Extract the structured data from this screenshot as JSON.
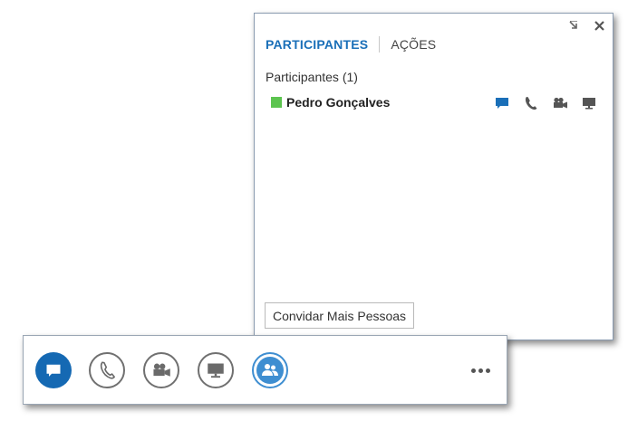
{
  "popup": {
    "tabs": [
      {
        "label": "PARTICIPANTES",
        "active": true
      },
      {
        "label": "AÇÕES",
        "active": false
      }
    ],
    "group_header": "Participantes (1)",
    "participants": [
      {
        "name": "Pedro Gonçalves",
        "presence_color": "#5cc44f"
      }
    ],
    "participant_action_icons": [
      "im-icon",
      "phone-icon",
      "video-icon",
      "screen-share-icon"
    ],
    "invite_button": "Convidar Mais Pessoas",
    "window_controls": [
      "popout-icon",
      "close-icon"
    ]
  },
  "toolbar": {
    "buttons": [
      {
        "icon": "im-icon",
        "state": "filled"
      },
      {
        "icon": "phone-icon",
        "state": "outline"
      },
      {
        "icon": "video-icon",
        "state": "outline"
      },
      {
        "icon": "screen-share-icon",
        "state": "outline"
      },
      {
        "icon": "people-icon",
        "state": "selected"
      }
    ],
    "more_icon": "more-options-icon"
  },
  "colors": {
    "accent": "#1a6fb8",
    "primary_button": "#1569b3",
    "selected_button": "#3e8ed1",
    "presence_available": "#5cc44f"
  }
}
